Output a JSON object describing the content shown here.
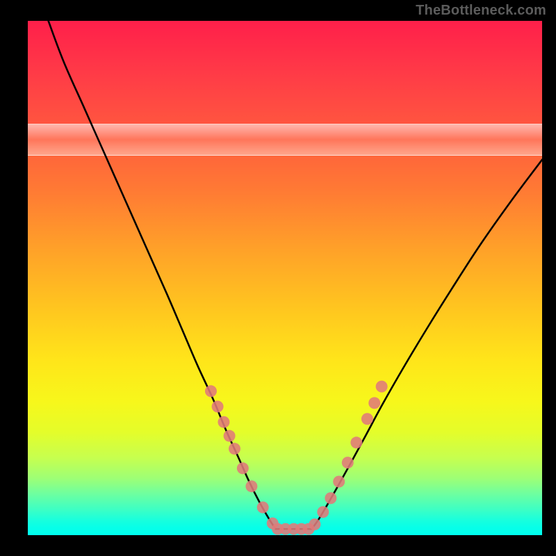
{
  "watermark": "TheBottleneck.com",
  "chart_data": {
    "type": "line",
    "title": "",
    "xlabel": "",
    "ylabel": "",
    "xlim": [
      0,
      100
    ],
    "ylim": [
      0,
      100
    ],
    "grid": false,
    "legend": null,
    "highlight_band": {
      "y_from": 74,
      "y_to": 80
    },
    "series": [
      {
        "name": "left-curve",
        "x": [
          4,
          7,
          11,
          15,
          19,
          23,
          27,
          30,
          33,
          36,
          38.5,
          41,
          43,
          45,
          47,
          48.2
        ],
        "y": [
          100,
          92,
          83,
          74,
          65,
          56,
          47,
          40,
          33,
          26.5,
          20.5,
          15,
          10.5,
          6.5,
          3,
          1.2
        ]
      },
      {
        "name": "right-curve",
        "x": [
          55.2,
          56.5,
          58,
          60,
          62.5,
          65.5,
          69,
          73,
          77.5,
          82.5,
          88,
          94,
          100
        ],
        "y": [
          1.2,
          3,
          5.5,
          9,
          13.5,
          19,
          25.5,
          32.5,
          40,
          48,
          56.5,
          65,
          73
        ]
      },
      {
        "name": "flat-bottom",
        "x": [
          48.2,
          55.2
        ],
        "y": [
          1.2,
          1.2
        ]
      }
    ],
    "markers": [
      {
        "group": "left-dots",
        "color": "#e07a7a",
        "points": [
          [
            35.6,
            28
          ],
          [
            36.9,
            25
          ],
          [
            38.1,
            22
          ],
          [
            39.2,
            19.3
          ],
          [
            40.2,
            16.8
          ],
          [
            41.8,
            13
          ],
          [
            43.5,
            9.5
          ],
          [
            45.7,
            5.4
          ],
          [
            47.6,
            2.3
          ]
        ]
      },
      {
        "group": "right-dots",
        "color": "#e07a7a",
        "points": [
          [
            55.8,
            2.1
          ],
          [
            57.4,
            4.5
          ],
          [
            58.9,
            7.2
          ],
          [
            60.5,
            10.4
          ],
          [
            62.2,
            14.1
          ],
          [
            63.9,
            18
          ],
          [
            66.0,
            22.6
          ],
          [
            67.4,
            25.7
          ],
          [
            68.8,
            28.9
          ]
        ]
      },
      {
        "group": "bottom-dots",
        "color": "#e07a7a",
        "points": [
          [
            48.6,
            1.2
          ],
          [
            50.1,
            1.2
          ],
          [
            51.7,
            1.2
          ],
          [
            53.2,
            1.2
          ],
          [
            54.6,
            1.2
          ]
        ]
      }
    ]
  }
}
